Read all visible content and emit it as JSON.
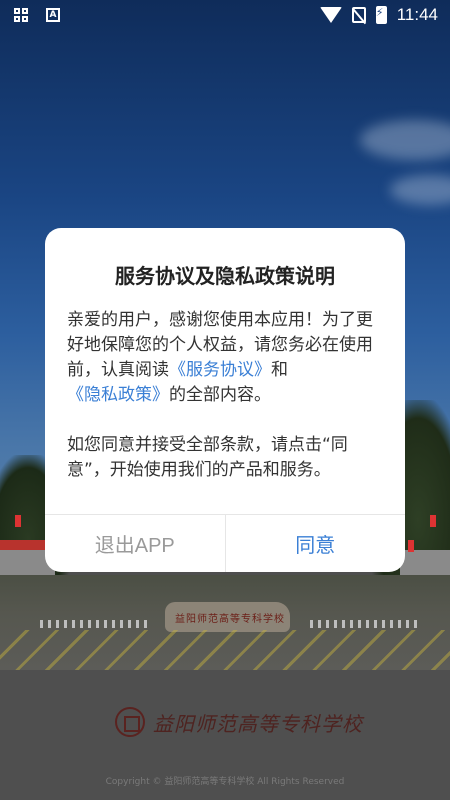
{
  "status_bar": {
    "time": "11:44",
    "icons": [
      "qr-scan-icon",
      "app-a-icon",
      "wifi-icon",
      "no-sim-icon",
      "battery-charging-icon"
    ]
  },
  "background": {
    "rock_inscription": "益阳师范高等专科学校",
    "logo_text": "益阳师范高等专科学校",
    "copyright": "Copyright © 益阳师范高等专科学校 All Rights Reserved"
  },
  "dialog": {
    "title": "服务协议及隐私政策说明",
    "para1_a": "亲爱的用户，感谢您使用本应用！为了更好地保障您的个人权益，请您务必在使用前，认真阅读",
    "link_service": "《服务协议》",
    "para1_b": "和",
    "link_privacy": "《隐私政策》",
    "para1_c": "的全部内容。",
    "para2": "如您同意并接受全部条款，请点击“同意”，开始使用我们的产品和服务。",
    "exit_label": "退出APP",
    "agree_label": "同意"
  },
  "colors": {
    "link": "#3a7fd5",
    "exit_text": "#9a9a9a",
    "overlay_bg": "#4e4e4e"
  }
}
